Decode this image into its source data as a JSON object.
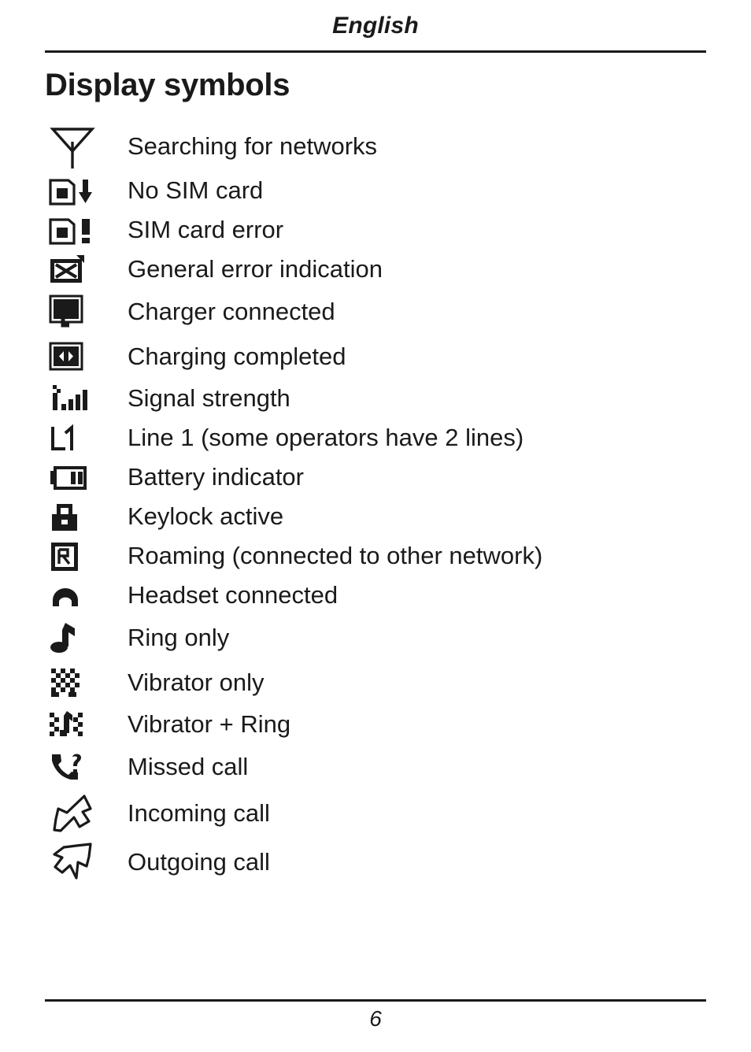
{
  "header": {
    "running_head": "English"
  },
  "title": "Display symbols",
  "symbols": [
    {
      "icon": "antenna-searching-icon",
      "label": "Searching for networks"
    },
    {
      "icon": "sim-card-missing-icon",
      "label": "No SIM card"
    },
    {
      "icon": "sim-card-error-icon",
      "label": "SIM card error"
    },
    {
      "icon": "general-error-icon",
      "label": "General error indication"
    },
    {
      "icon": "charger-connected-icon",
      "label": "Charger connected"
    },
    {
      "icon": "charging-completed-icon",
      "label": "Charging completed"
    },
    {
      "icon": "signal-strength-icon",
      "label": "Signal strength"
    },
    {
      "icon": "line-1-icon",
      "label": "Line 1 (some operators have 2 lines)"
    },
    {
      "icon": "battery-indicator-icon",
      "label": "Battery indicator"
    },
    {
      "icon": "keylock-icon",
      "label": "Keylock active"
    },
    {
      "icon": "roaming-icon",
      "label": "Roaming (connected to other network)"
    },
    {
      "icon": "headset-connected-icon",
      "label": "Headset connected"
    },
    {
      "icon": "ring-only-icon",
      "label": "Ring only"
    },
    {
      "icon": "vibrator-only-icon",
      "label": "Vibrator only"
    },
    {
      "icon": "vibrator-plus-ring-icon",
      "label": "Vibrator + Ring"
    },
    {
      "icon": "missed-call-icon",
      "label": "Missed call"
    },
    {
      "icon": "incoming-call-icon",
      "label": "Incoming call"
    },
    {
      "icon": "outgoing-call-icon",
      "label": "Outgoing call"
    }
  ],
  "footer": {
    "page_number": "6"
  },
  "colors": {
    "ink": "#1a1a1a",
    "paper": "#ffffff"
  }
}
